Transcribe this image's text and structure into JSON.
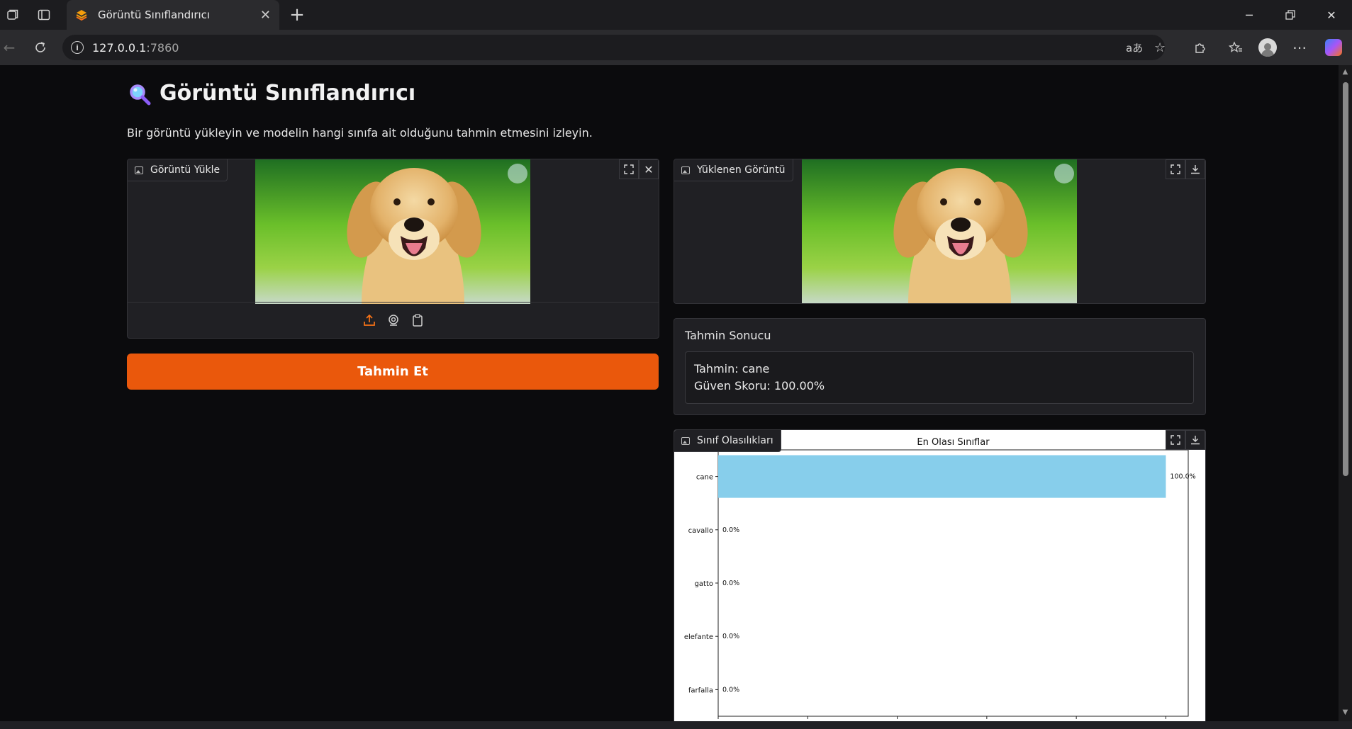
{
  "browser": {
    "tab_title": "Görüntü Sınıflandırıcı",
    "url_host": "127.0.0.1",
    "url_port": ":7860",
    "read_aloud": "aあ"
  },
  "app": {
    "title": "Görüntü Sınıflandırıcı",
    "subtitle": "Bir görüntü yükleyin ve modelin hangi sınıfa ait olduğunu tahmin etmesini izleyin.",
    "upload_panel": {
      "label": "Görüntü Yükle"
    },
    "preview_panel": {
      "label": "Yüklenen Görüntü"
    },
    "predict_button": "Tahmin Et",
    "result": {
      "title": "Tahmin Sonucu",
      "line1": "Tahmin: cane",
      "line2": "Güven Skoru: 100.00%"
    },
    "probabilities_panel": {
      "label": "Sınıf Olasılıkları"
    },
    "accent_color": "#ea580c"
  },
  "chart_data": {
    "type": "bar",
    "orientation": "horizontal",
    "title": "En Olası Sınıflar",
    "categories": [
      "cane",
      "cavallo",
      "gatto",
      "elefante",
      "farfalla"
    ],
    "values": [
      100.0,
      0.0,
      0.0,
      0.0,
      0.0
    ],
    "value_labels": [
      "100.0%",
      "0.0%",
      "0.0%",
      "0.0%",
      "0.0%"
    ],
    "xlim": [
      0,
      105
    ],
    "bar_color": "#87ceeb",
    "xlabel": "",
    "ylabel": ""
  }
}
